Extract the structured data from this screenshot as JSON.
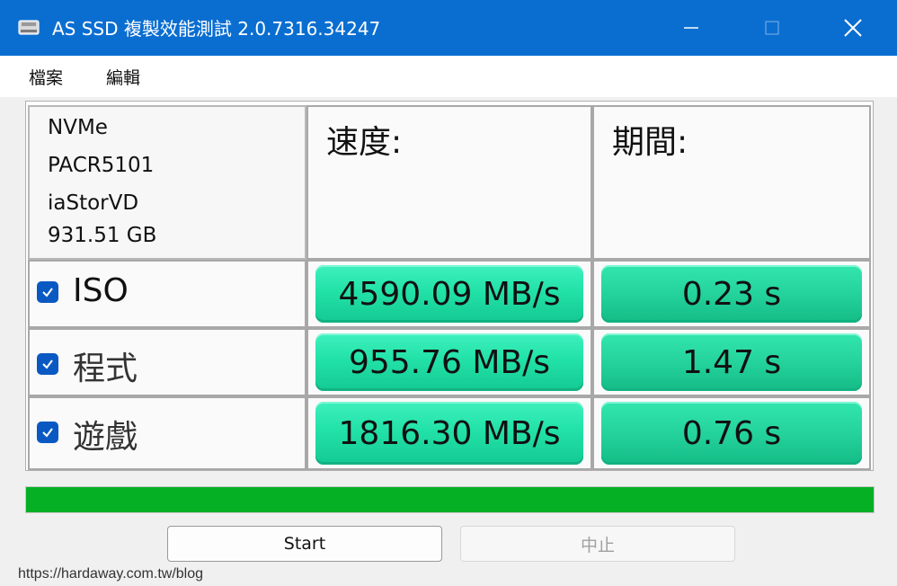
{
  "window": {
    "title": "AS SSD 複製效能測試 2.0.7316.34247",
    "icons": {
      "app": "drive-icon",
      "minimize": "minimize-icon",
      "maximize": "maximize-icon",
      "close": "close-icon"
    }
  },
  "menu": {
    "file": "檔案",
    "edit": "編輯"
  },
  "drive": {
    "type": "NVMe",
    "model": "PACR5101",
    "driver": "iaStorVD",
    "capacity": "931.51 GB"
  },
  "headers": {
    "speed": "速度:",
    "time": "期間:"
  },
  "rows": [
    {
      "label": "ISO",
      "checked": true,
      "speed": "4590.09 MB/s",
      "time": "0.23 s"
    },
    {
      "label": "程式",
      "checked": true,
      "speed": "955.76 MB/s",
      "time": "1.47 s"
    },
    {
      "label": "遊戲",
      "checked": true,
      "speed": "1816.30 MB/s",
      "time": "0.76 s"
    }
  ],
  "progress": {
    "value": 1.0,
    "color": "#06b025"
  },
  "buttons": {
    "start": "Start",
    "stop": "中止"
  },
  "watermark": "https://hardaway.com.tw/blog",
  "colors": {
    "titlebar": "#0a6ed1",
    "result": "#22e2a8",
    "checkbox": "#0a59c2"
  }
}
